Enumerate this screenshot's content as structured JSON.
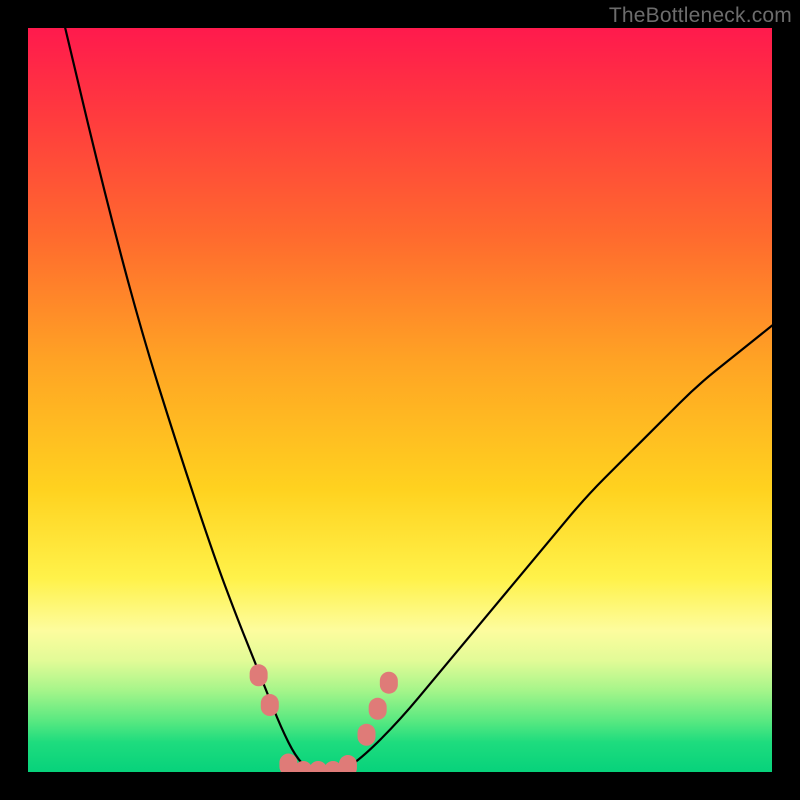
{
  "watermark": "TheBottleneck.com",
  "chart_data": {
    "type": "line",
    "title": "",
    "xlabel": "",
    "ylabel": "",
    "xlim": [
      0,
      100
    ],
    "ylim": [
      0,
      100
    ],
    "grid": false,
    "legend": false,
    "background_gradient": {
      "direction": "vertical",
      "stops": [
        {
          "pct": 0,
          "color": "#ff1a4d"
        },
        {
          "pct": 12,
          "color": "#ff3b3e"
        },
        {
          "pct": 28,
          "color": "#ff6a2e"
        },
        {
          "pct": 45,
          "color": "#ffa424"
        },
        {
          "pct": 62,
          "color": "#ffd21f"
        },
        {
          "pct": 74,
          "color": "#fff24a"
        },
        {
          "pct": 81,
          "color": "#fdfc9e"
        },
        {
          "pct": 85,
          "color": "#e2fb97"
        },
        {
          "pct": 89,
          "color": "#a6f58a"
        },
        {
          "pct": 93,
          "color": "#5be981"
        },
        {
          "pct": 96,
          "color": "#1edc7e"
        },
        {
          "pct": 100,
          "color": "#07d27b"
        }
      ]
    },
    "series": [
      {
        "name": "bottleneck-curve",
        "color": "#000000",
        "stroke_width": 2.2,
        "x": [
          5,
          10,
          15,
          20,
          25,
          28,
          30,
          32,
          34,
          36,
          38,
          40,
          42,
          45,
          50,
          55,
          60,
          65,
          70,
          75,
          80,
          85,
          90,
          95,
          100
        ],
        "y": [
          100,
          79,
          60,
          44,
          29,
          21,
          16,
          11,
          6,
          2,
          0,
          0,
          0,
          2,
          7,
          13,
          19,
          25,
          31,
          37,
          42,
          47,
          52,
          56,
          60
        ]
      }
    ],
    "markers": [
      {
        "name": "sample-points",
        "color": "#df7b78",
        "shape": "rounded-rect",
        "points": [
          {
            "x": 31.0,
            "y": 13.0
          },
          {
            "x": 32.5,
            "y": 9.0
          },
          {
            "x": 35.0,
            "y": 1.0
          },
          {
            "x": 37.0,
            "y": 0.0
          },
          {
            "x": 39.0,
            "y": 0.0
          },
          {
            "x": 41.0,
            "y": 0.0
          },
          {
            "x": 43.0,
            "y": 0.8
          },
          {
            "x": 45.5,
            "y": 5.0
          },
          {
            "x": 47.0,
            "y": 8.5
          },
          {
            "x": 48.5,
            "y": 12.0
          }
        ]
      }
    ]
  }
}
